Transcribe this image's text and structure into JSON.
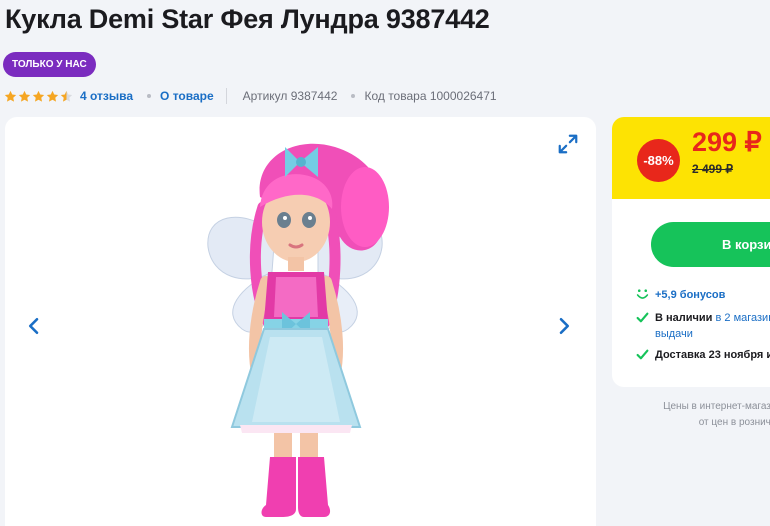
{
  "product": {
    "title": "Кукла Demi Star Фея Лундра 9387442",
    "badge": "ТОЛЬКО У НАС",
    "rating": 4.5,
    "reviews_label": "4 отзыва",
    "about_label": "О товаре",
    "article_label": "Артикул 9387442",
    "code_label": "Код товара 1000026471"
  },
  "gallery": {
    "prev_icon": "chevron-left-icon",
    "next_icon": "chevron-right-icon",
    "expand_icon": "expand-icon"
  },
  "pricing": {
    "discount": "-88%",
    "price": "299 ₽",
    "old_price": "2 499 ₽"
  },
  "buy": {
    "cart_button": "В корзи",
    "bonus": "+5,9 бонусов",
    "stock_prefix": "В наличии",
    "stock_link": "в 2 магазин",
    "stock_link2": "выдачи",
    "delivery": "Доставка 23 ноября и"
  },
  "note": {
    "line1": "Цены в интернет-магазин",
    "line2": "от цен в рознични"
  },
  "colors": {
    "accent_blue": "#1a6ec5",
    "badge_purple": "#7b2cbf",
    "price_red": "#e8271b",
    "price_bg_yellow": "#fde303",
    "cart_green": "#16c35a",
    "star_gold": "#f5a623"
  }
}
